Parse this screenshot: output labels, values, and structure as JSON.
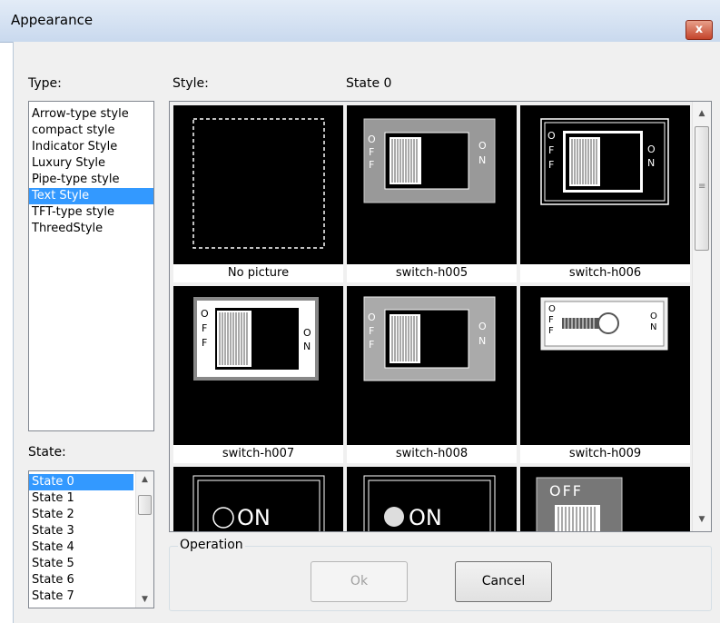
{
  "window": {
    "title": "Appearance",
    "close_glyph": "x"
  },
  "type_section": {
    "label": "Type:",
    "items": [
      "Arrow-type style",
      "compact style",
      "Indicator Style",
      "Luxury Style",
      "Pipe-type style",
      "Text Style",
      "TFT-type style",
      "ThreedStyle"
    ],
    "selected": "Text Style"
  },
  "style_section": {
    "label": "Style:",
    "state_label": "State 0"
  },
  "state_section": {
    "label": "State:",
    "items": [
      "State 0",
      "State 1",
      "State 2",
      "State 3",
      "State 4",
      "State 5",
      "State 6",
      "State 7"
    ],
    "selected": "State 0"
  },
  "gallery": {
    "captions": [
      "No picture",
      "switch-h005",
      "switch-h006",
      "switch-h007",
      "switch-h008",
      "switch-h009"
    ],
    "partial_row_texts": {
      "a": "ON",
      "b": "ON",
      "c": "OFF"
    },
    "switch_letters": {
      "off": [
        "O",
        "F",
        "F"
      ],
      "on": [
        "O",
        "N"
      ]
    }
  },
  "operation": {
    "label": "Operation",
    "ok_label": "Ok",
    "cancel_label": "Cancel",
    "ok_enabled": false
  },
  "colors": {
    "selection": "#3399ff",
    "cell_bg": "#000000",
    "close_button": "#c4442b"
  }
}
